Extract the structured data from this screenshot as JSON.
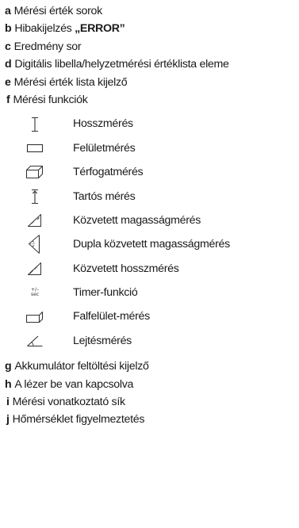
{
  "items_top": [
    {
      "letter": "a",
      "text": "Mérési érték sorok"
    },
    {
      "letter": "b",
      "text": "Hibakijelzés ",
      "strong": "„ERROR”"
    },
    {
      "letter": "c",
      "text": "Eredmény sor"
    },
    {
      "letter": "d",
      "text": "Digitális libella/helyzetmérési értéklista eleme"
    },
    {
      "letter": "e",
      "text": "Mérési érték lista kijelző"
    },
    {
      "letter": "f",
      "text": "Mérési funkciók"
    }
  ],
  "functions": [
    {
      "icon": "length-measure-icon",
      "label": "Hosszmérés"
    },
    {
      "icon": "area-measure-icon",
      "label": "Felületmérés"
    },
    {
      "icon": "volume-measure-icon",
      "label": "Térfogatmérés"
    },
    {
      "icon": "continuous-measure-icon",
      "label": "Tartós mérés"
    },
    {
      "icon": "indirect-height-icon",
      "label": "Közvetett magasságmérés"
    },
    {
      "icon": "double-indirect-height-icon",
      "label": "Dupla közvetett magasságmérés"
    },
    {
      "icon": "indirect-length-icon",
      "label": "Közvetett hosszmérés"
    },
    {
      "icon": "timer-icon",
      "label": "Timer-funkció",
      "glyph_top": "+/–",
      "glyph_bottom": "sec"
    },
    {
      "icon": "wall-area-icon",
      "label": "Falfelület-mérés"
    },
    {
      "icon": "slope-measure-icon",
      "label": "Lejtésmérés"
    }
  ],
  "items_bottom": [
    {
      "letter": "g",
      "text": "Akkumulátor feltöltési kijelző"
    },
    {
      "letter": "h",
      "text": "A lézer be van kapcsolva"
    },
    {
      "letter": "i",
      "text": "Mérési vonatkoztató sík"
    },
    {
      "letter": "j",
      "text": "Hőmérséklet figyelmeztetés"
    }
  ]
}
